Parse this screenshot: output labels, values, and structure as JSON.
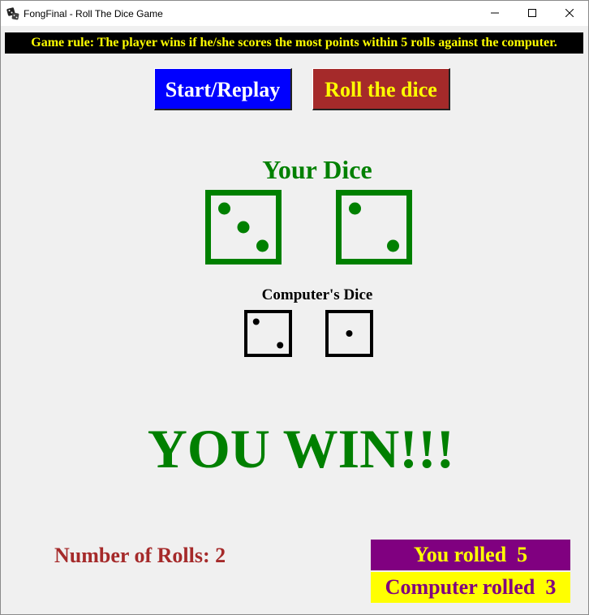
{
  "window": {
    "title": "FongFinal - Roll The Dice Game",
    "icon": "dice-icon",
    "controls": [
      "minimize-icon",
      "maximize-icon",
      "close-icon"
    ]
  },
  "rule": "Game rule: The player wins if he/she scores the most points within 5 rolls against the computer.",
  "buttons": {
    "start_label": "Start/Replay",
    "roll_label": "Roll the dice"
  },
  "player": {
    "title": "Your Dice",
    "dice": [
      3,
      2
    ],
    "color": "#008000"
  },
  "computer": {
    "title": "Computer's Dice",
    "dice": [
      2,
      1
    ],
    "color": "#000000"
  },
  "result": "YOU WIN!!!",
  "rolls_label": "Number of Rolls: 2",
  "scores": {
    "you_rolled": "You rolled  5",
    "computer_rolled": "Computer rolled  3"
  },
  "colors": {
    "start_bg": "#0000ff",
    "roll_bg": "#a52a2a",
    "rule_bg": "#000000",
    "rule_fg": "#ffff00",
    "you_bg": "#800080",
    "comp_bg": "#ffff00"
  }
}
